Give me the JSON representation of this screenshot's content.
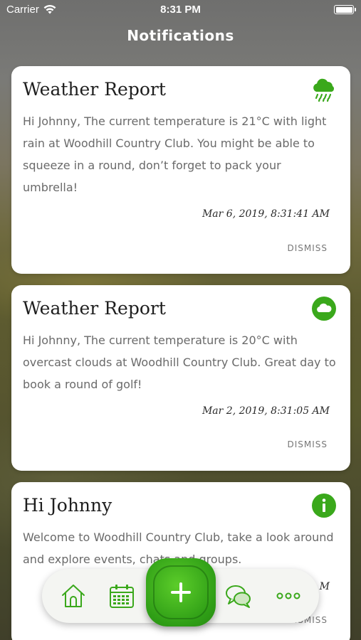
{
  "status_bar": {
    "carrier": "Carrier",
    "time": "8:31 PM"
  },
  "header": {
    "title": "Notifications"
  },
  "notifications": [
    {
      "title": "Weather Report",
      "icon": "rain-cloud-icon",
      "body": "Hi Johnny, The current temperature is 21°C with light rain at Woodhill Country Club. You might be able to squeeze in a round, don’t forget to pack your umbrella!",
      "date": "Mar 6, 2019, 8:31:41 AM",
      "action": "DISMISS"
    },
    {
      "title": "Weather Report",
      "icon": "cloud-icon",
      "body": "Hi Johnny, The current temperature is 20°C with overcast clouds at Woodhill Country Club. Great day to book a round of golf!",
      "date": "Mar 2, 2019, 8:31:05 AM",
      "action": "DISMISS"
    },
    {
      "title": "Hi Johnny",
      "icon": "info-icon",
      "body": "Welcome to Woodhill Country Club, take a look around and explore events, chats and groups.",
      "date": "M",
      "action": "DISMISS"
    }
  ],
  "bottom_nav": {
    "items": [
      {
        "icon": "home-icon"
      },
      {
        "icon": "calendar-icon"
      },
      {
        "icon": "plus-icon"
      },
      {
        "icon": "chat-icon"
      },
      {
        "icon": "more-icon"
      }
    ]
  },
  "colors": {
    "accent": "#3aa81b",
    "card": "#ffffff",
    "text": "#6a6a6a"
  }
}
